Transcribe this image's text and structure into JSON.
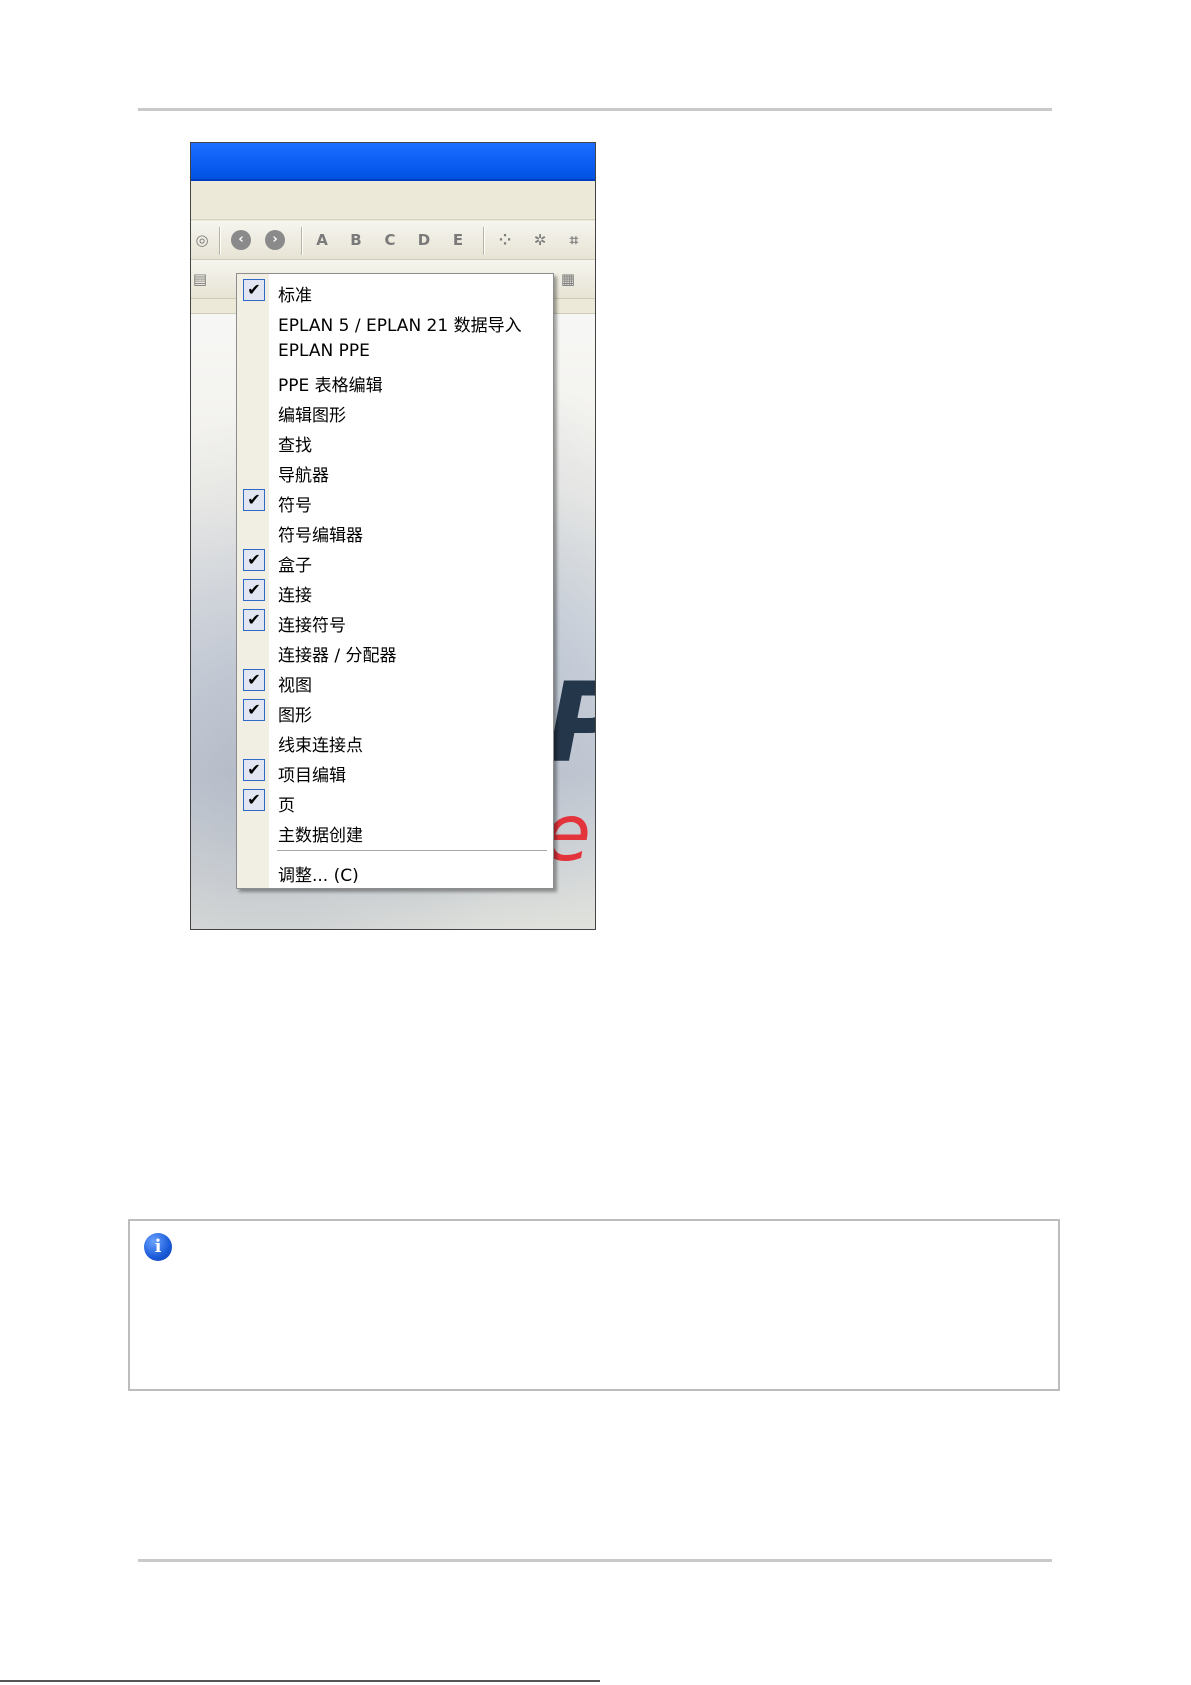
{
  "menu": {
    "items": [
      {
        "label": "标准",
        "checked": true
      },
      {
        "label": "EPLAN 5 / EPLAN 21 数据导入",
        "checked": false
      },
      {
        "label": "EPLAN PPE",
        "checked": false
      },
      {
        "label": "PPE 表格编辑",
        "checked": false
      },
      {
        "label": "编辑图形",
        "checked": false
      },
      {
        "label": "查找",
        "checked": false
      },
      {
        "label": "导航器",
        "checked": false
      },
      {
        "label": "符号",
        "checked": true
      },
      {
        "label": "符号编辑器",
        "checked": false
      },
      {
        "label": "盒子",
        "checked": true
      },
      {
        "label": "连接",
        "checked": true
      },
      {
        "label": "连接符号",
        "checked": true
      },
      {
        "label": "连接器 / 分配器",
        "checked": false
      },
      {
        "label": "视图",
        "checked": true
      },
      {
        "label": "图形",
        "checked": true
      },
      {
        "label": "线束连接点",
        "checked": false
      },
      {
        "label": "项目编辑",
        "checked": true
      },
      {
        "label": "页",
        "checked": true
      },
      {
        "label": "主数据创建",
        "checked": false
      }
    ],
    "customize_label": "调整... (C)",
    "check_glyph": "✔"
  },
  "toolbar": {
    "icons": [
      "settings-icon",
      "back-icon",
      "forward-icon",
      "text-a-icon",
      "text-b-icon",
      "text-c-icon",
      "text-d-icon",
      "text-e-icon",
      "grid-icon",
      "snap-icon",
      "crosshair-icon"
    ]
  },
  "info_box": {
    "icon": "info-icon",
    "icon_glyph": "i",
    "accent": "#1a5ad8"
  },
  "colors": {
    "titlebar": "#0a5cf2",
    "menu_check_border": "#316ac5"
  }
}
